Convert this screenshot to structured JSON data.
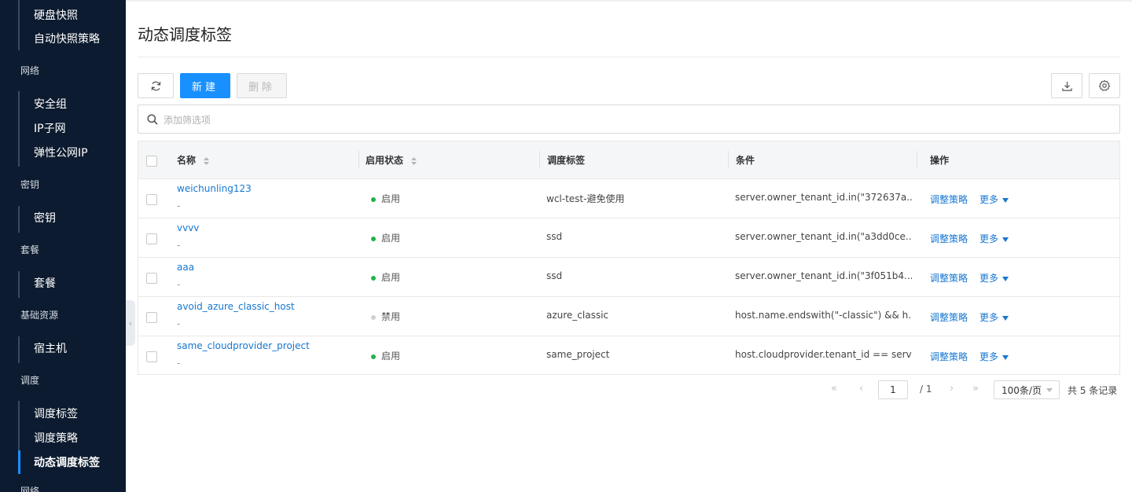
{
  "sidebar": {
    "items": [
      {
        "label": "硬盘快照"
      },
      {
        "label": "自动快照策略"
      },
      {
        "group": "网络"
      },
      {
        "label": "安全组"
      },
      {
        "label": "IP子网"
      },
      {
        "label": "弹性公网IP"
      },
      {
        "group": "密钥"
      },
      {
        "label": "密钥"
      },
      {
        "group": "套餐"
      },
      {
        "label": "套餐"
      },
      {
        "group": "基础资源"
      },
      {
        "label": "宿主机"
      },
      {
        "group": "调度"
      },
      {
        "label": "调度标签"
      },
      {
        "label": "调度策略"
      },
      {
        "label": "动态调度标签",
        "active": true
      },
      {
        "group": "网络"
      }
    ]
  },
  "page": {
    "title": "动态调度标签"
  },
  "toolbar": {
    "refresh_icon": "refresh-icon",
    "new_label": "新建",
    "delete_label": "删除",
    "download_icon": "download-icon",
    "settings_icon": "gear-icon"
  },
  "search": {
    "placeholder": "添加筛选项",
    "value": ""
  },
  "table": {
    "headers": {
      "name": "名称",
      "status": "启用状态",
      "tag": "调度标签",
      "condition": "条件",
      "action": "操作"
    },
    "rows": [
      {
        "name": "weichunling123",
        "desc": "-",
        "status": "启用",
        "enabled": true,
        "tag": "wcl-test-避免使用",
        "condition": "server.owner_tenant_id.in(\"372637a...",
        "action1": "调整策略",
        "action2": "更多"
      },
      {
        "name": "vvvv",
        "desc": "-",
        "status": "启用",
        "enabled": true,
        "tag": "ssd",
        "condition": "server.owner_tenant_id.in(\"a3dd0ce...",
        "action1": "调整策略",
        "action2": "更多"
      },
      {
        "name": "aaa",
        "desc": "-",
        "status": "启用",
        "enabled": true,
        "tag": "ssd",
        "condition": "server.owner_tenant_id.in(\"3f051b4...",
        "action1": "调整策略",
        "action2": "更多"
      },
      {
        "name": "avoid_azure_classic_host",
        "desc": "-",
        "status": "禁用",
        "enabled": false,
        "tag": "azure_classic",
        "condition": "host.name.endswith(\"-classic\") && h...",
        "action1": "调整策略",
        "action2": "更多"
      },
      {
        "name": "same_cloudprovider_project",
        "desc": "-",
        "status": "启用",
        "enabled": true,
        "tag": "same_project",
        "condition": "host.cloudprovider.tenant_id == serv...",
        "action1": "调整策略",
        "action2": "更多"
      }
    ]
  },
  "pagination": {
    "current": "1",
    "total_pages": "/ 1",
    "page_size": "100条/页",
    "total": "共 5 条记录"
  },
  "colors": {
    "sidebar_bg": "#0c1b2f",
    "primary": "#1890ff",
    "link": "#1677d2",
    "enabled": "#22b14c",
    "disabled": "#d0d0d0"
  }
}
